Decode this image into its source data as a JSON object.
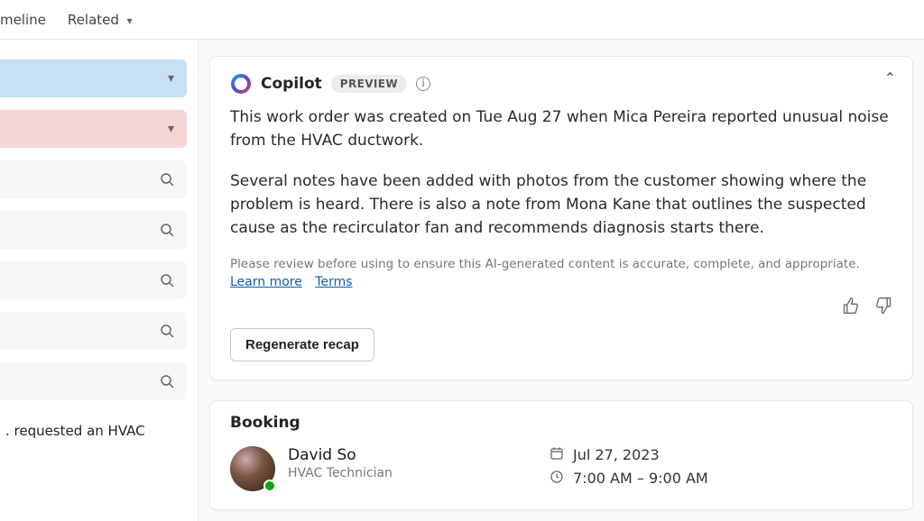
{
  "tabs": {
    "timeline": "meline",
    "related": "Related"
  },
  "sidebar": {
    "footer_text": ". requested an HVAC"
  },
  "copilot": {
    "title": "Copilot",
    "preview_label": "PREVIEW",
    "p1": "This work order was created on Tue Aug 27 when Mica Pereira reported unusual noise from the HVAC ductwork.",
    "p2": "Several notes have been added with photos from the customer showing where the problem is heard. There is also a note from Mona Kane that outlines the suspected cause as the recirculator fan and recommends diagnosis starts there.",
    "disclaimer": "Please review before using to ensure this AI-generated content is accurate, complete, and appropriate.",
    "learn_more": "Learn more",
    "terms": "Terms",
    "regenerate": "Regenerate recap"
  },
  "booking": {
    "section_title": "Booking",
    "resource_name": "David So",
    "resource_role": "HVAC Technician",
    "date": "Jul 27, 2023",
    "time": "7:00 AM – 9:00 AM"
  }
}
